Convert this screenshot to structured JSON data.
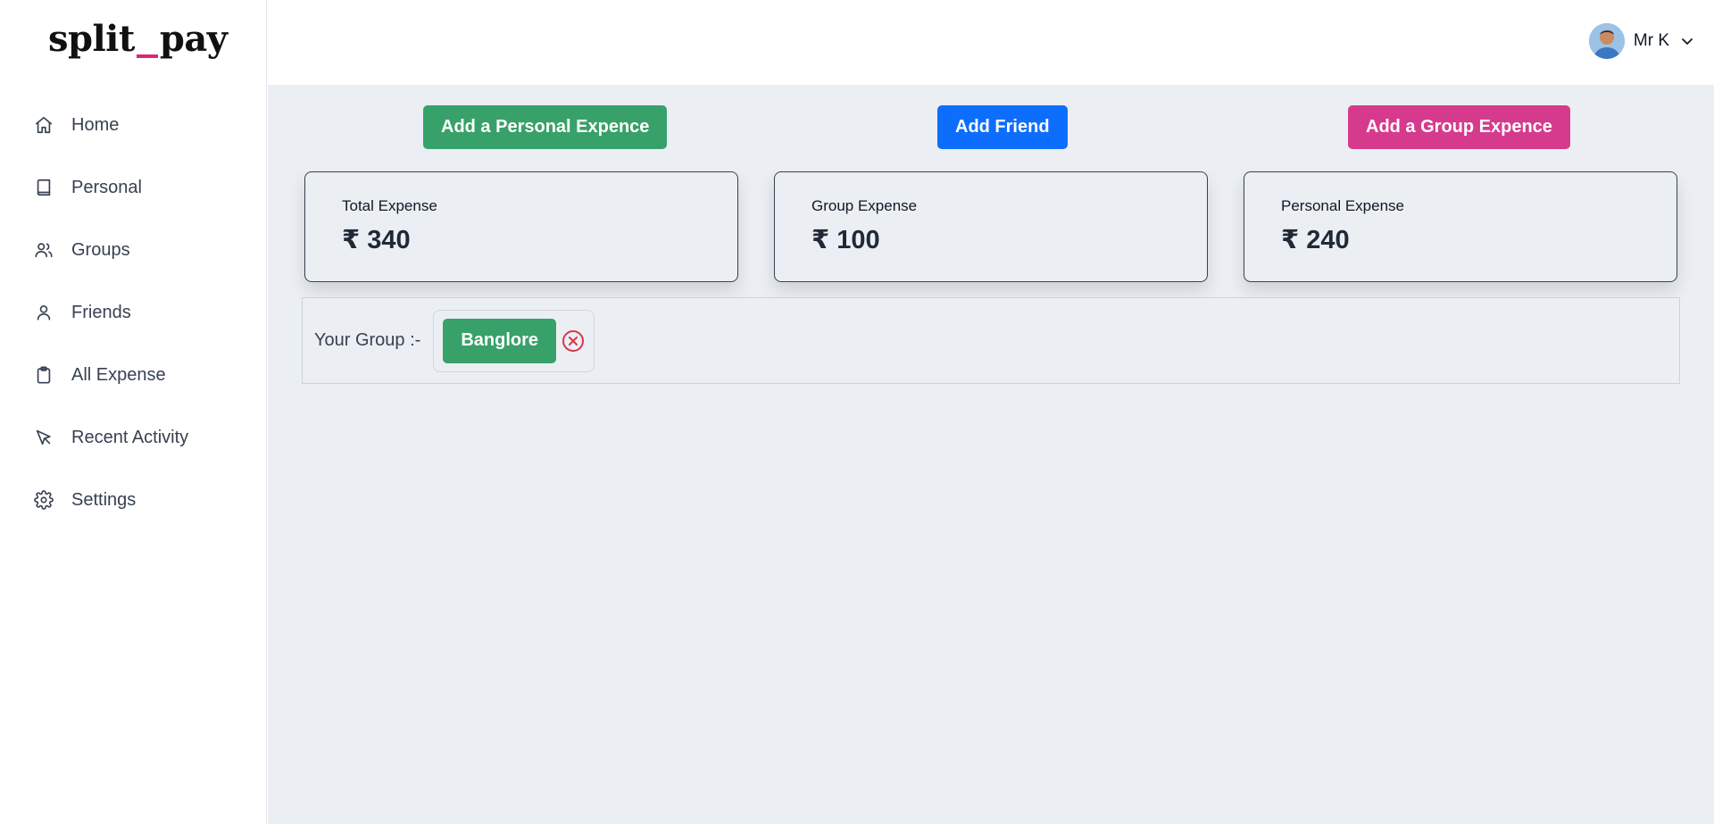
{
  "app": {
    "logo_left": "split",
    "logo_right": "pay"
  },
  "sidebar": {
    "items": [
      {
        "label": "Home",
        "icon": "home-icon"
      },
      {
        "label": "Personal",
        "icon": "book-icon"
      },
      {
        "label": "Groups",
        "icon": "users-icon"
      },
      {
        "label": "Friends",
        "icon": "user-icon"
      },
      {
        "label": "All Expense",
        "icon": "clipboard-icon"
      },
      {
        "label": "Recent Activity",
        "icon": "cursor-icon"
      },
      {
        "label": "Settings",
        "icon": "gear-icon"
      }
    ]
  },
  "header": {
    "user_name": "Mr K"
  },
  "actions": {
    "personal_label": "Add a Personal Expence",
    "friend_label": "Add Friend",
    "group_label": "Add a Group Expence"
  },
  "stats": [
    {
      "title": "Total Expense",
      "value": "₹ 340"
    },
    {
      "title": "Group Expense",
      "value": "₹ 100"
    },
    {
      "title": "Personal Expense",
      "value": "₹ 240"
    }
  ],
  "groups": {
    "label": "Your Group :-",
    "items": [
      {
        "name": "Banglore"
      }
    ]
  },
  "colors": {
    "green": "#38a169",
    "blue": "#0d6efd",
    "pink": "#d63a8d",
    "logo_accent": "#db2777",
    "remove": "#dc3545"
  }
}
